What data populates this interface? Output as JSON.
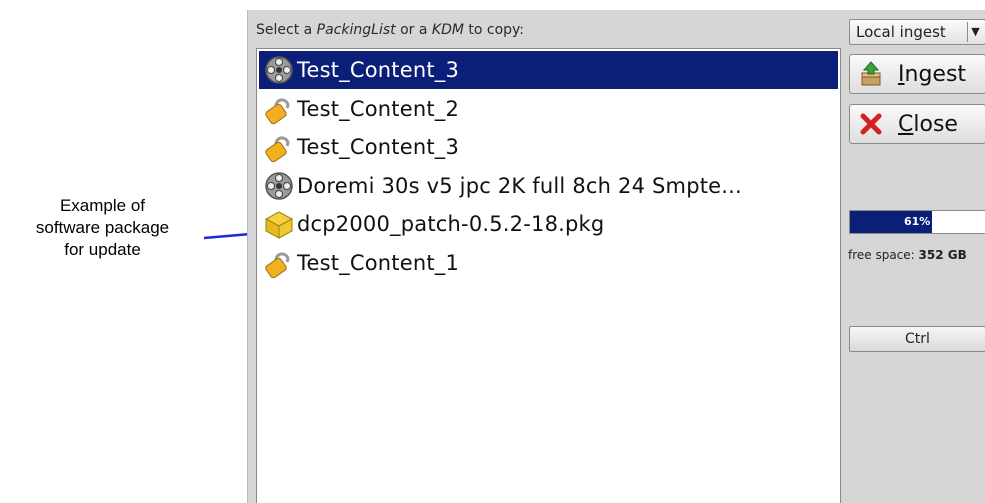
{
  "annotation": {
    "lines": [
      "Example of",
      "software package",
      "for update"
    ]
  },
  "prompt": {
    "prefix": "Select a ",
    "packinglist": "PackingList",
    "middle": " or a ",
    "kdm": "KDM",
    "suffix": " to copy:"
  },
  "list": {
    "items": [
      {
        "label": "Test_Content_3",
        "icon": "film-reel-icon",
        "selected": true
      },
      {
        "label": "Test_Content_2",
        "icon": "padlock-icon",
        "selected": false
      },
      {
        "label": "Test_Content_3",
        "icon": "padlock-icon",
        "selected": false
      },
      {
        "label": "Doremi 30s v5 jpc 2K full 8ch 24 Smpte...",
        "icon": "film-reel-icon",
        "selected": false
      },
      {
        "label": "dcp2000_patch-0.5.2-18.pkg",
        "icon": "package-icon",
        "selected": false
      },
      {
        "label": "Test_Content_1",
        "icon": "padlock-icon",
        "selected": false
      }
    ]
  },
  "right_panel": {
    "ingest_mode": "Local ingest",
    "ingest_button": {
      "mnemonic": "I",
      "rest": "ngest"
    },
    "close_button": {
      "mnemonic": "C",
      "rest": "lose"
    },
    "progress": {
      "percent": 61,
      "label": "61%"
    },
    "free_space": {
      "prefix": "free space: ",
      "value": "352 GB"
    },
    "ctrl_button": "Ctrl"
  },
  "colors": {
    "selection": "#0c1f78",
    "panel_bg": "#d6d6d6"
  }
}
